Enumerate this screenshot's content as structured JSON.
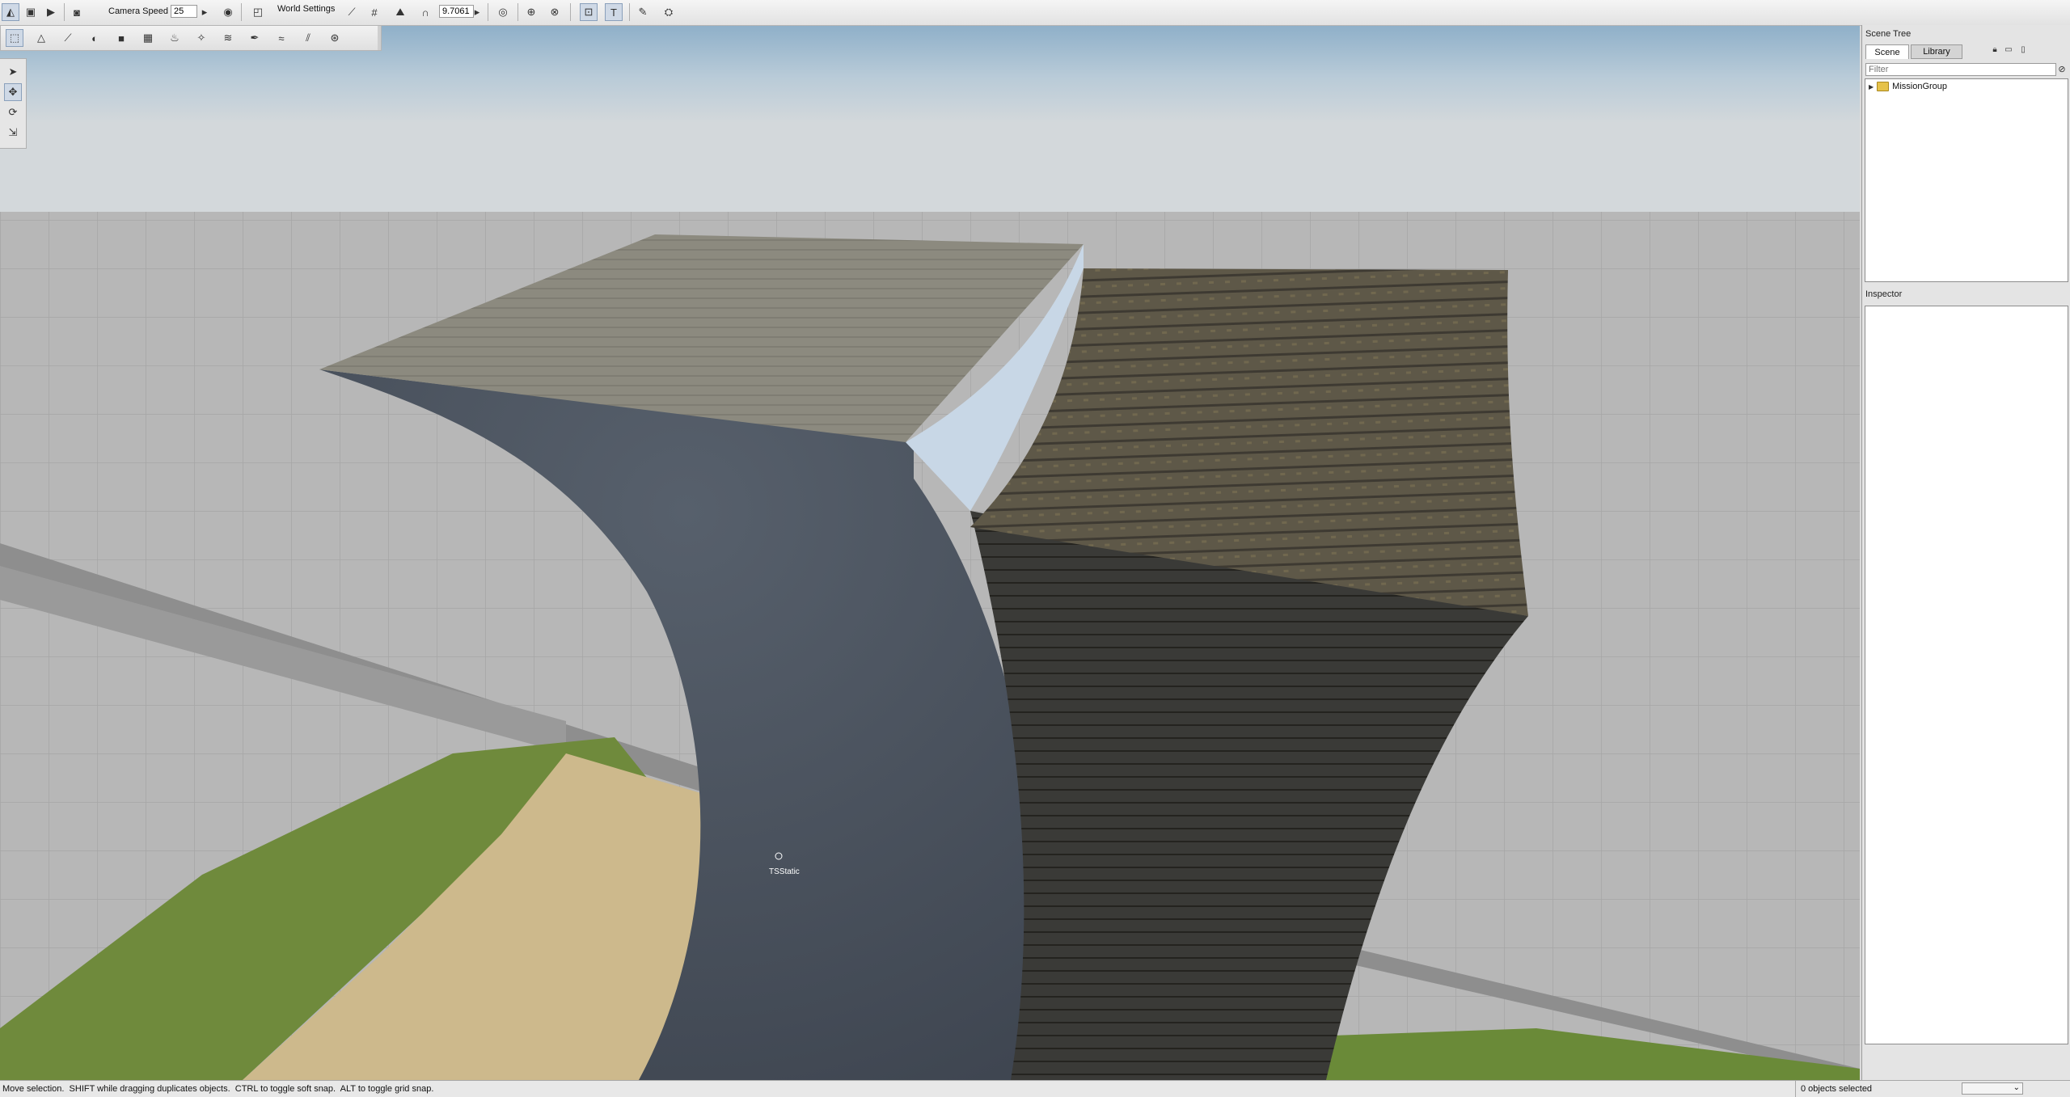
{
  "toolbar": {
    "camera_speed_label": "Camera Speed",
    "camera_speed_value": "25",
    "world_settings_label": "World Settings",
    "snap_value": "9.7061"
  },
  "viewport": {
    "object_label": "TSStatic"
  },
  "scene_tree": {
    "title": "Scene Tree",
    "tabs": [
      {
        "label": "Scene",
        "selected": true
      },
      {
        "label": "Library",
        "selected": false
      }
    ],
    "filter_placeholder": "Filter",
    "items": [
      {
        "label": "MissionGroup",
        "icon": "folder-icon",
        "expanded": false
      }
    ]
  },
  "inspector": {
    "title": "Inspector"
  },
  "status": {
    "hint": "Move selection.  SHIFT while dragging duplicates objects.  CTRL to toggle soft snap.  ALT to toggle grid snap.",
    "selection": "0 objects selected",
    "dropdown_value": ""
  },
  "colors": {
    "accent": "#cfd9e6",
    "sky_top": "#8fb0c9",
    "ground": "#b9b9b9",
    "ramp_dark": "#4f5763",
    "ramp_wood": "#6c6453"
  }
}
